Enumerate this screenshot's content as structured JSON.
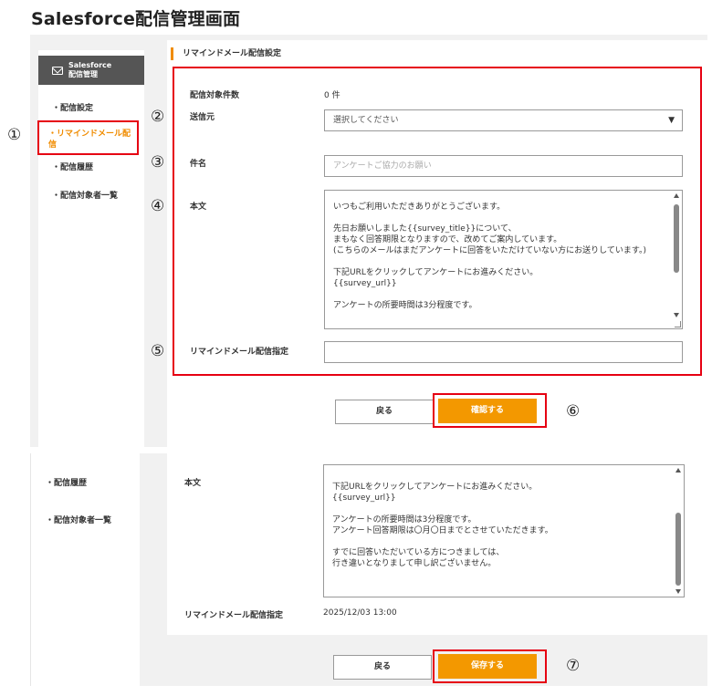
{
  "page_title": "Salesforce配信管理画面",
  "brand": {
    "line1": "Salesforce",
    "line2": "配信管理"
  },
  "sidebar": {
    "items": [
      {
        "label": "・配信設定"
      },
      {
        "label": "・リマインドメール配信"
      },
      {
        "label": "・配信履歴"
      },
      {
        "label": "・配信対象者一覧"
      }
    ]
  },
  "section_title": "リマインドメール配信設定",
  "form": {
    "count_label": "配信対象件数",
    "count_value": "0 件",
    "sender_label": "送信元",
    "sender_selected": "選択してください",
    "subject_label": "件名",
    "subject_placeholder": "アンケートご協力のお願い",
    "body_label": "本文",
    "body_text": "いつもご利用いただきありがとうございます。\n\n先日お願いしました{{survey_title}}について、\nまもなく回答期限となりますので、改めてご案内しています。\n(こちらのメールはまだアンケートに回答をいただけていない方にお送りしています。)\n\n下記URLをクリックしてアンケートにお進みください。\n{{survey_url}}\n\nアンケートの所要時間は3分程度です。",
    "schedule_label": "リマインドメール配信指定",
    "schedule_value": ""
  },
  "buttons": {
    "back": "戻る",
    "confirm": "確認する",
    "save": "保存する"
  },
  "confirm_view": {
    "body_label": "本文",
    "body_text": "下記URLをクリックしてアンケートにお進みください。\n{{survey_url}}\n\nアンケートの所要時間は3分程度です。\nアンケート回答期限は〇月〇日までとさせていただきます。\n\nすでに回答いただいている方につきましては、\n行き違いとなりまして申し訳ございません。",
    "schedule_label": "リマインドメール配信指定",
    "schedule_value": "2025/12/03 13:00"
  },
  "markers": {
    "m1": "①",
    "m2": "②",
    "m3": "③",
    "m4": "④",
    "m5": "⑤",
    "m6": "⑥",
    "m7": "⑦"
  },
  "colors": {
    "accent": "#f39800",
    "highlight": "#e60012",
    "brand_bg": "#555555"
  }
}
